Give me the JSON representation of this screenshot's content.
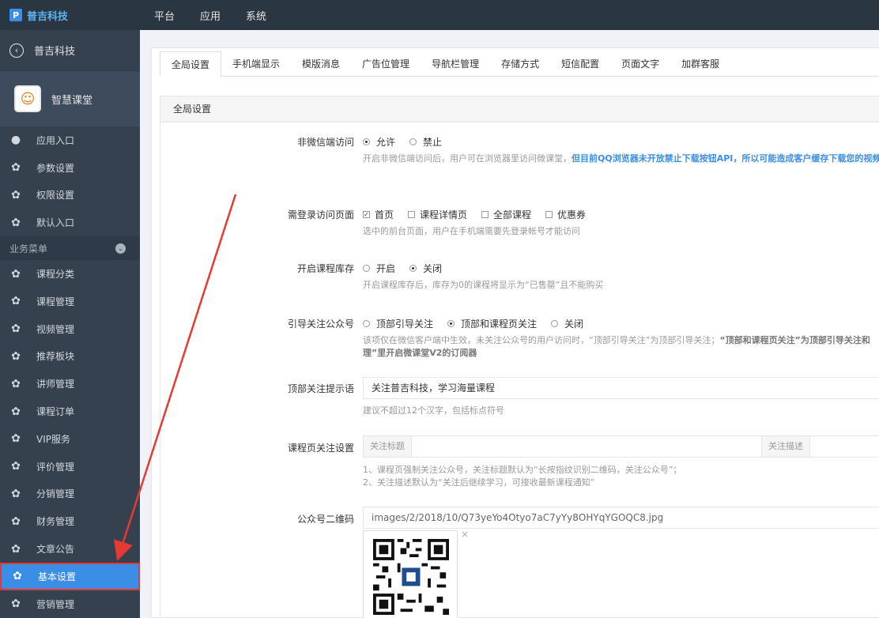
{
  "topbar": {
    "brand": "普吉科技",
    "brand_logo": "P",
    "nav": [
      "平台",
      "应用",
      "系统"
    ]
  },
  "sidebar": {
    "back_label": "普吉科技",
    "back_icon": "arrow-left-circle-icon",
    "app_name": "智慧课堂",
    "top_items": [
      {
        "label": "应用入口",
        "icon": "chat-icon"
      },
      {
        "label": "参数设置",
        "icon": "gear-icon"
      },
      {
        "label": "权限设置",
        "icon": "gear-icon"
      },
      {
        "label": "默认入口",
        "icon": "gear-icon"
      }
    ],
    "section_label": "业务菜单",
    "items": [
      {
        "label": "课程分类"
      },
      {
        "label": "课程管理"
      },
      {
        "label": "视频管理"
      },
      {
        "label": "推荐板块"
      },
      {
        "label": "讲师管理"
      },
      {
        "label": "课程订单"
      },
      {
        "label": "VIP服务"
      },
      {
        "label": "评价管理"
      },
      {
        "label": "分销管理"
      },
      {
        "label": "财务管理"
      },
      {
        "label": "文章公告"
      },
      {
        "label": "基本设置",
        "active": true
      },
      {
        "label": "营销管理"
      }
    ],
    "active_color": "#3a8ee6",
    "highlight_border": "#e53935"
  },
  "tabs": [
    "全局设置",
    "手机端显示",
    "模版消息",
    "广告位管理",
    "导航栏管理",
    "存储方式",
    "短信配置",
    "页面文字",
    "加群客服"
  ],
  "section_title": "全局设置",
  "form": {
    "non_wechat": {
      "label": "非微信端访问",
      "options": [
        "允许",
        "禁止"
      ],
      "selected": "允许",
      "hint_prefix": "开启非微信端访问后，用户可在浏览器里访问微课堂，",
      "hint_bold": "但目前QQ浏览器未开放禁止下载按钮API，所以可能造成客户缓存下载您的视频"
    },
    "login_pages": {
      "label": "需登录访问页面",
      "options": [
        "首页",
        "课程详情页",
        "全部课程",
        "优惠券"
      ],
      "checked": [
        "首页"
      ],
      "hint": "选中的前台页面，用户在手机端需要先登录帐号才能访问"
    },
    "stock": {
      "label": "开启课程库存",
      "options": [
        "开启",
        "关闭"
      ],
      "selected": "关闭",
      "hint": "开启课程库存后，库存为0的课程将显示为“已售罄”且不能购买"
    },
    "follow": {
      "label": "引导关注公众号",
      "options": [
        "顶部引导关注",
        "顶部和课程页关注",
        "关闭"
      ],
      "selected": "顶部和课程页关注",
      "hint_line1_a": "该项仅在微信客户端中生效，未关注公众号的用户访问时，“顶部引导关注”为顶部引导关注；",
      "hint_line1_b": "“顶部和课程页关注”为顶部引导关注和",
      "hint_line2": "理”里开启微课堂V2的订阅器"
    },
    "top_tip": {
      "label": "顶部关注提示语",
      "value": "关注普吉科技，学习海量课程",
      "hint": "建议不超过12个汉字，包括标点符号"
    },
    "course_follow": {
      "label": "课程页关注设置",
      "title_placeholder": "关注标题",
      "desc_placeholder": "关注描述",
      "hint1": "1、课程页强制关注公众号，关注标题默认为“长按指纹识别二维码，关注公众号”；",
      "hint2": "2、关注描述默认为“关注后继续学习，可接收最新课程通知”"
    },
    "qrcode": {
      "label": "公众号二维码",
      "value": "images/2/2018/10/Q73yeYo4Otyo7aC7yYy8OHYqYGOQC8.jpg",
      "close": "×"
    }
  }
}
